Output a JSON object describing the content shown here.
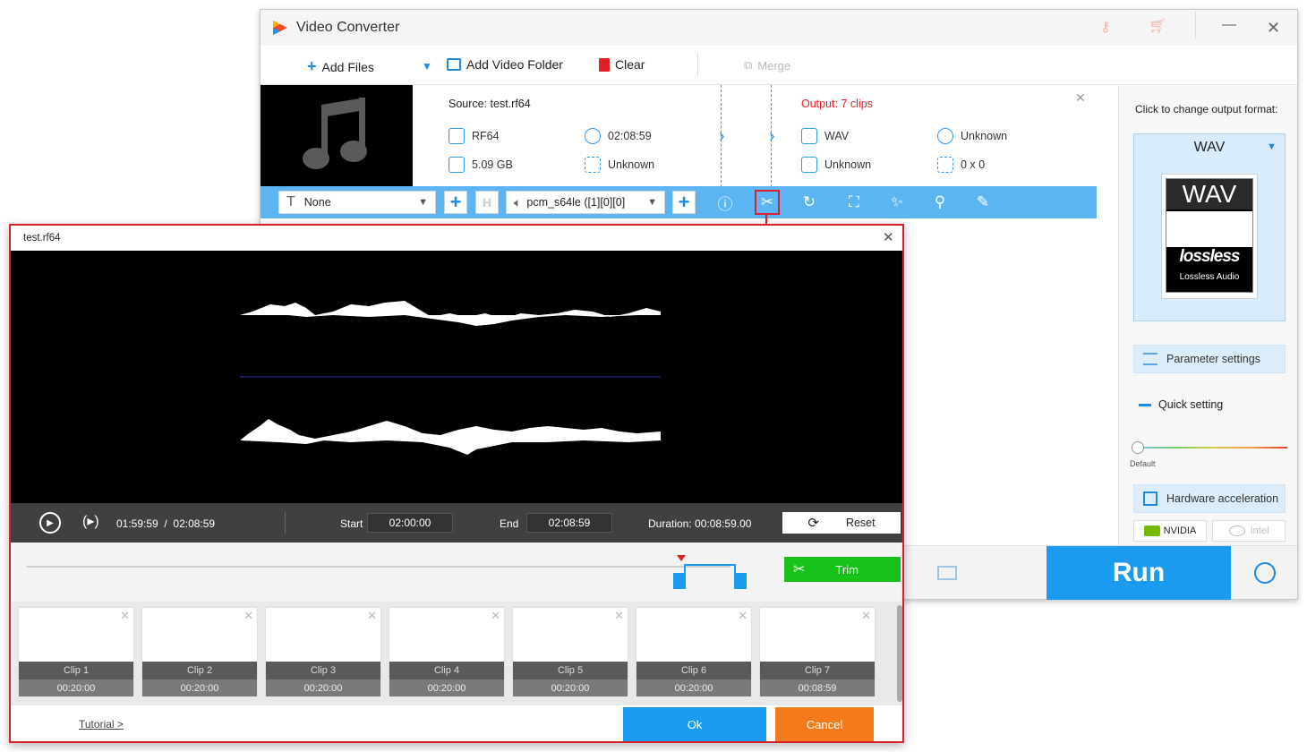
{
  "window": {
    "title": "Video Converter"
  },
  "toolbar": {
    "add_files": "Add Files",
    "add_folder": "Add Video Folder",
    "clear": "Clear",
    "merge": "Merge"
  },
  "source": {
    "label": "Source: test.rf64",
    "format": "RF64",
    "duration": "02:08:59",
    "size": "5.09 GB",
    "resolution": "Unknown"
  },
  "output": {
    "label": "Output: 7 clips",
    "format": "WAV",
    "duration": "Unknown",
    "size": "Unknown",
    "resolution": "0 x 0"
  },
  "strip": {
    "subtitle": "None",
    "audio": "pcm_s64le ([1][0][0]"
  },
  "panel": {
    "click_label": "Click to change output format:",
    "format": "WAV",
    "badge_text": "WAV",
    "lossless_logo": "lossless",
    "lossless_sub": "Lossless Audio",
    "param_settings": "Parameter settings",
    "quick_setting": "Quick setting",
    "default_label": "Default",
    "hw_accel": "Hardware acceleration",
    "nvidia": "NVIDIA",
    "intel": "Intel"
  },
  "run": {
    "label": "Run"
  },
  "dialog": {
    "title": "test.rf64",
    "current_time": "01:59:59",
    "total_time": "02:08:59",
    "start_label": "Start",
    "start_value": "02:00:00",
    "end_label": "End",
    "end_value": "02:08:59",
    "duration_label": "Duration:",
    "duration_value": "00:08:59.00",
    "reset": "Reset",
    "trim": "Trim",
    "tutorial": "Tutorial >",
    "ok": "Ok",
    "cancel": "Cancel",
    "clips": [
      {
        "name": "Clip 1",
        "duration": "00:20:00"
      },
      {
        "name": "Clip 2",
        "duration": "00:20:00"
      },
      {
        "name": "Clip 3",
        "duration": "00:20:00"
      },
      {
        "name": "Clip 4",
        "duration": "00:20:00"
      },
      {
        "name": "Clip 5",
        "duration": "00:20:00"
      },
      {
        "name": "Clip 6",
        "duration": "00:20:00"
      },
      {
        "name": "Clip 7",
        "duration": "00:08:59"
      }
    ]
  },
  "colors": {
    "accent": "#1b9bf0",
    "output_red": "#e02020",
    "trim_green": "#19c21a",
    "cancel_orange": "#f57a1b",
    "highlight_red": "#d7202a"
  }
}
